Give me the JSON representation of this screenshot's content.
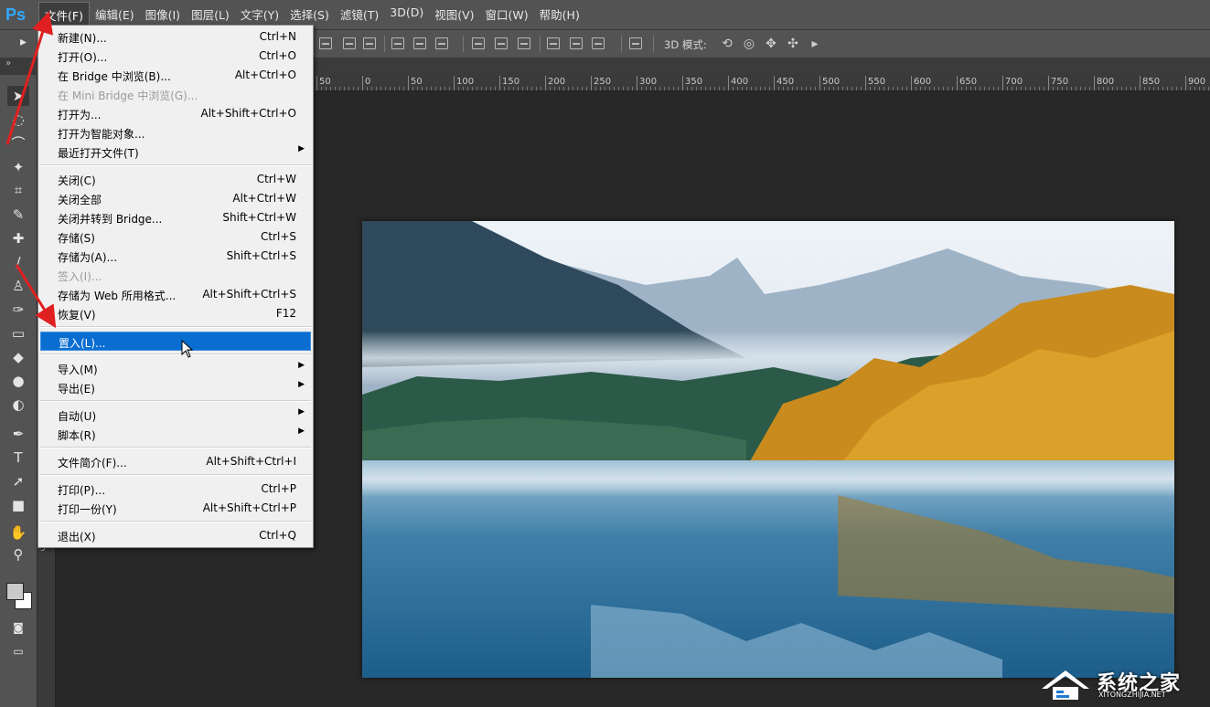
{
  "app": {
    "logo": "Ps"
  },
  "menubar": {
    "items": [
      {
        "label": "文件(F)",
        "active": true
      },
      {
        "label": "编辑(E)"
      },
      {
        "label": "图像(I)"
      },
      {
        "label": "图层(L)"
      },
      {
        "label": "文字(Y)"
      },
      {
        "label": "选择(S)"
      },
      {
        "label": "滤镜(T)"
      },
      {
        "label": "3D(D)"
      },
      {
        "label": "视图(V)"
      },
      {
        "label": "窗口(W)"
      },
      {
        "label": "帮助(H)"
      }
    ]
  },
  "options_bar": {
    "mode3d_label": "3D 模式:",
    "icons_3d": [
      "rotate-3d-icon",
      "roll-3d-icon",
      "pan-3d-icon",
      "slide-3d-icon",
      "scale-3d-icon"
    ]
  },
  "ruler": {
    "h_labels": [
      "50",
      "0",
      "50",
      "100",
      "150",
      "200",
      "250",
      "300",
      "350",
      "400",
      "450",
      "500",
      "550",
      "600",
      "650",
      "700",
      "750",
      "800",
      "850",
      "900"
    ],
    "v_labels": [
      "5"
    ]
  },
  "toolbar": {
    "tools": [
      "move-tool-icon",
      "marquee-tool-icon",
      "lasso-tool-icon",
      "magic-wand-tool-icon",
      "crop-tool-icon",
      "eyedropper-tool-icon",
      "healing-brush-tool-icon",
      "brush-tool-icon",
      "clone-stamp-tool-icon",
      "history-brush-tool-icon",
      "eraser-tool-icon",
      "paint-bucket-tool-icon",
      "blur-tool-icon",
      "dodge-tool-icon",
      "pen-tool-icon",
      "type-tool-icon",
      "path-selection-tool-icon",
      "rectangle-tool-icon",
      "hand-tool-icon",
      "zoom-tool-icon"
    ],
    "type_tool_glyph": "T",
    "foreground_color": "#c9c9c9",
    "background_color": "#ffffff"
  },
  "file_menu": {
    "groups": [
      [
        {
          "label": "新建(N)...",
          "shortcut": "Ctrl+N"
        },
        {
          "label": "打开(O)...",
          "shortcut": "Ctrl+O"
        },
        {
          "label": "在 Bridge 中浏览(B)...",
          "shortcut": "Alt+Ctrl+O"
        },
        {
          "label": "在 Mini Bridge 中浏览(G)...",
          "shortcut": "",
          "disabled": true
        },
        {
          "label": "打开为...",
          "shortcut": "Alt+Shift+Ctrl+O"
        },
        {
          "label": "打开为智能对象...",
          "shortcut": ""
        },
        {
          "label": "最近打开文件(T)",
          "shortcut": "",
          "submenu": true
        }
      ],
      [
        {
          "label": "关闭(C)",
          "shortcut": "Ctrl+W"
        },
        {
          "label": "关闭全部",
          "shortcut": "Alt+Ctrl+W"
        },
        {
          "label": "关闭并转到 Bridge...",
          "shortcut": "Shift+Ctrl+W"
        },
        {
          "label": "存储(S)",
          "shortcut": "Ctrl+S"
        },
        {
          "label": "存储为(A)...",
          "shortcut": "Shift+Ctrl+S"
        },
        {
          "label": "签入(I)...",
          "shortcut": "",
          "disabled": true
        },
        {
          "label": "存储为 Web 所用格式...",
          "shortcut": "Alt+Shift+Ctrl+S"
        },
        {
          "label": "恢复(V)",
          "shortcut": "F12"
        }
      ],
      [
        {
          "label": "置入(L)...",
          "shortcut": "",
          "highlighted": true
        }
      ],
      [
        {
          "label": "导入(M)",
          "shortcut": "",
          "submenu": true
        },
        {
          "label": "导出(E)",
          "shortcut": "",
          "submenu": true
        }
      ],
      [
        {
          "label": "自动(U)",
          "shortcut": "",
          "submenu": true
        },
        {
          "label": "脚本(R)",
          "shortcut": "",
          "submenu": true
        }
      ],
      [
        {
          "label": "文件简介(F)...",
          "shortcut": "Alt+Shift+Ctrl+I"
        }
      ],
      [
        {
          "label": "打印(P)...",
          "shortcut": "Ctrl+P"
        },
        {
          "label": "打印一份(Y)",
          "shortcut": "Alt+Shift+Ctrl+P"
        }
      ],
      [
        {
          "label": "退出(X)",
          "shortcut": "Ctrl+Q"
        }
      ]
    ],
    "submenu_glyph": "▶"
  },
  "colors": {
    "annotation_arrow": "#e02020",
    "menu_highlight": "#0a6ed1"
  },
  "watermark": {
    "cn": "系统之家",
    "en": "XITONGZHIJIA.NET"
  }
}
